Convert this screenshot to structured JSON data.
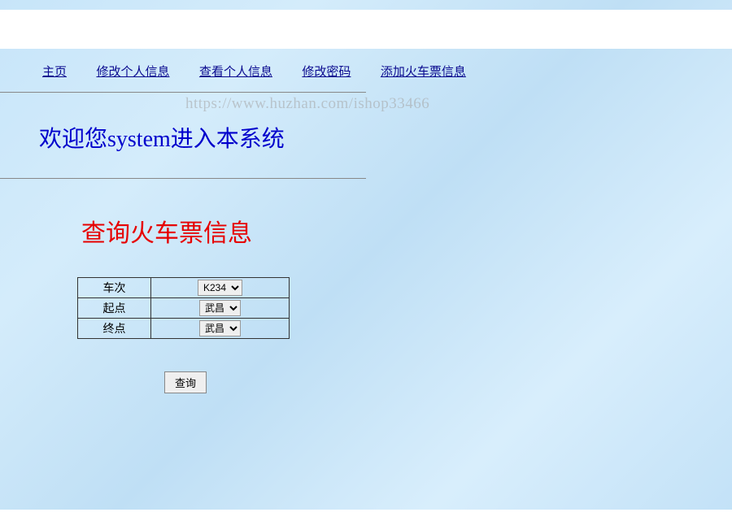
{
  "nav": {
    "home": "主页",
    "edit_profile": "修改个人信息",
    "view_profile": "查看个人信息",
    "change_password": "修改密码",
    "add_ticket": "添加火车票信息"
  },
  "watermark": "https://www.huzhan.com/ishop33466",
  "welcome": "欢迎您system进入本系统",
  "section_title": "查询火车票信息",
  "form": {
    "train_label": "车次",
    "train_value": "K234",
    "start_label": "起点",
    "start_value": "武昌",
    "end_label": "终点",
    "end_value": "武昌",
    "query_button": "查询"
  }
}
